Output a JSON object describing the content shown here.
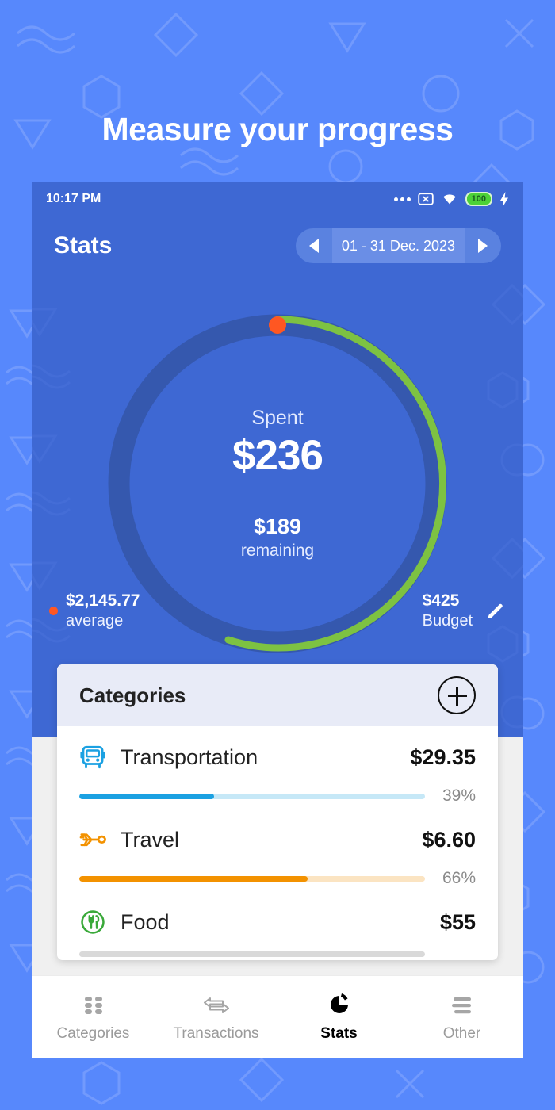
{
  "banner": {
    "headline": "Measure your progress",
    "bg_color": "#5788fc"
  },
  "phone": {
    "app_bg": "#3e68d3",
    "status_bar": {
      "time": "10:17 PM",
      "icons": [
        "more-dots-icon",
        "no-sim-icon",
        "wifi-icon",
        "battery-icon",
        "charging-bolt-icon"
      ],
      "battery_level": "100"
    },
    "header": {
      "title": "Stats",
      "date_range": "01 - 31 Dec. 2023",
      "prev_label": "◀",
      "next_label": "▶"
    },
    "donut": {
      "spent_label": "Spent",
      "spent_value": "$236",
      "remaining_value": "$189",
      "remaining_label": "remaining",
      "average_value": "$2,145.77",
      "average_label": "average",
      "budget_value": "$425",
      "budget_label": "Budget",
      "edit_icon": "pencil-icon",
      "track_color": "#3558ae",
      "progress_color": "#7dc242",
      "marker_color": "#ff5722"
    },
    "categories": {
      "title": "Categories",
      "add_label": "+",
      "items": [
        {
          "name": "Transportation",
          "amount": "$29.35",
          "percent": "39%",
          "pct_value": 39,
          "color": "#1ba1e2",
          "track": "#c6e8f7",
          "icon": "bus-icon"
        },
        {
          "name": "Travel",
          "amount": "$6.60",
          "percent": "66%",
          "pct_value": 66,
          "color": "#f39200",
          "track": "#fbe4c2",
          "icon": "airplane-icon"
        },
        {
          "name": "Food",
          "amount": "$55",
          "percent": "",
          "pct_value": 0,
          "color": "#d9d9d9",
          "track": "#d9d9d9",
          "icon": "restaurant-icon"
        }
      ]
    },
    "bottom_nav": {
      "items": [
        {
          "label": "Categories",
          "icon": "grid-icon",
          "active": false
        },
        {
          "label": "Transactions",
          "icon": "swap-arrows-icon",
          "active": false
        },
        {
          "label": "Stats",
          "icon": "donut-chart-icon",
          "active": true
        },
        {
          "label": "Other",
          "icon": "menu-lines-icon",
          "active": false
        }
      ]
    }
  },
  "chart_data": {
    "type": "pie",
    "title": "Spent",
    "labels": [
      "Spent",
      "Remaining"
    ],
    "values": [
      236,
      189
    ],
    "total_budget": 425,
    "percent_spent": 55.5,
    "annotations": [
      "$2,145.77 average",
      "$425 Budget"
    ],
    "colors": [
      "#7dc242",
      "#3558ae"
    ]
  }
}
